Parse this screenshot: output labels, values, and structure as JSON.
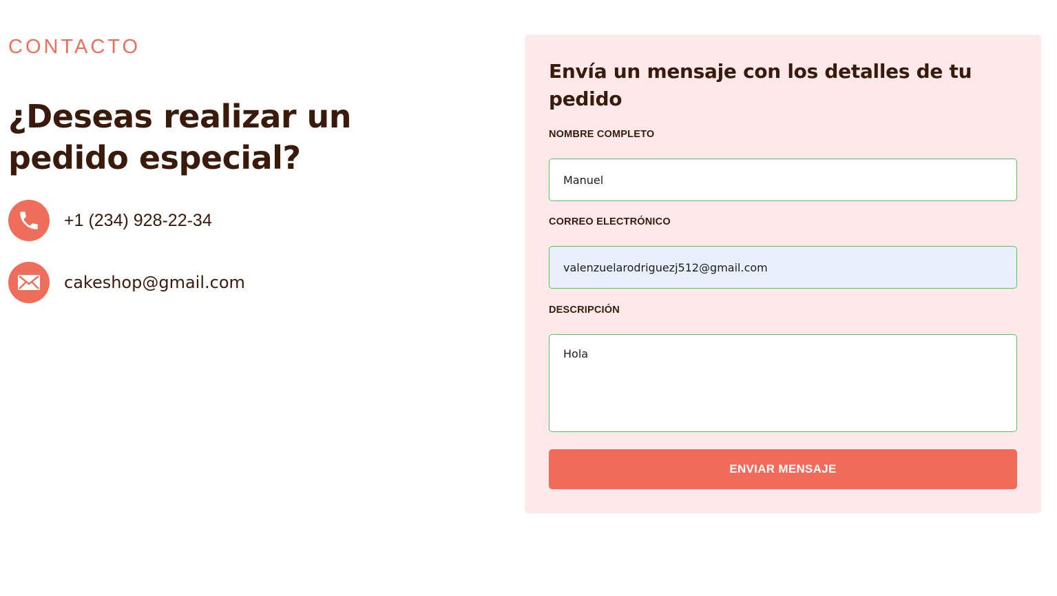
{
  "contact": {
    "eyebrow": "CONTACTO",
    "headline": "¿Deseas realizar un pedido especial?",
    "phone": {
      "icon": "phone-icon",
      "text": "+1 (234) 928-22-34"
    },
    "email": {
      "icon": "mail-icon",
      "text": "cakeshop@gmail.com"
    }
  },
  "form": {
    "title": "Envía un mensaje con los detalles de tu pedido",
    "name": {
      "label": "NOMBRE COMPLETO",
      "value": "Manuel"
    },
    "email": {
      "label": "CORREO ELECTRÓNICO",
      "value": "valenzuelarodriguezj512@gmail.com"
    },
    "description": {
      "label": "DESCRIPCIÓN",
      "value": "Hola"
    },
    "submit_label": "ENVIAR MENSAJE"
  },
  "colors": {
    "accent": "#ee6e5b",
    "button": "#f06b5a",
    "text_dark": "#3a1a0a",
    "card_bg": "#fde9e9",
    "input_border": "#5cc160",
    "autofill_bg": "#e8f0fe"
  }
}
